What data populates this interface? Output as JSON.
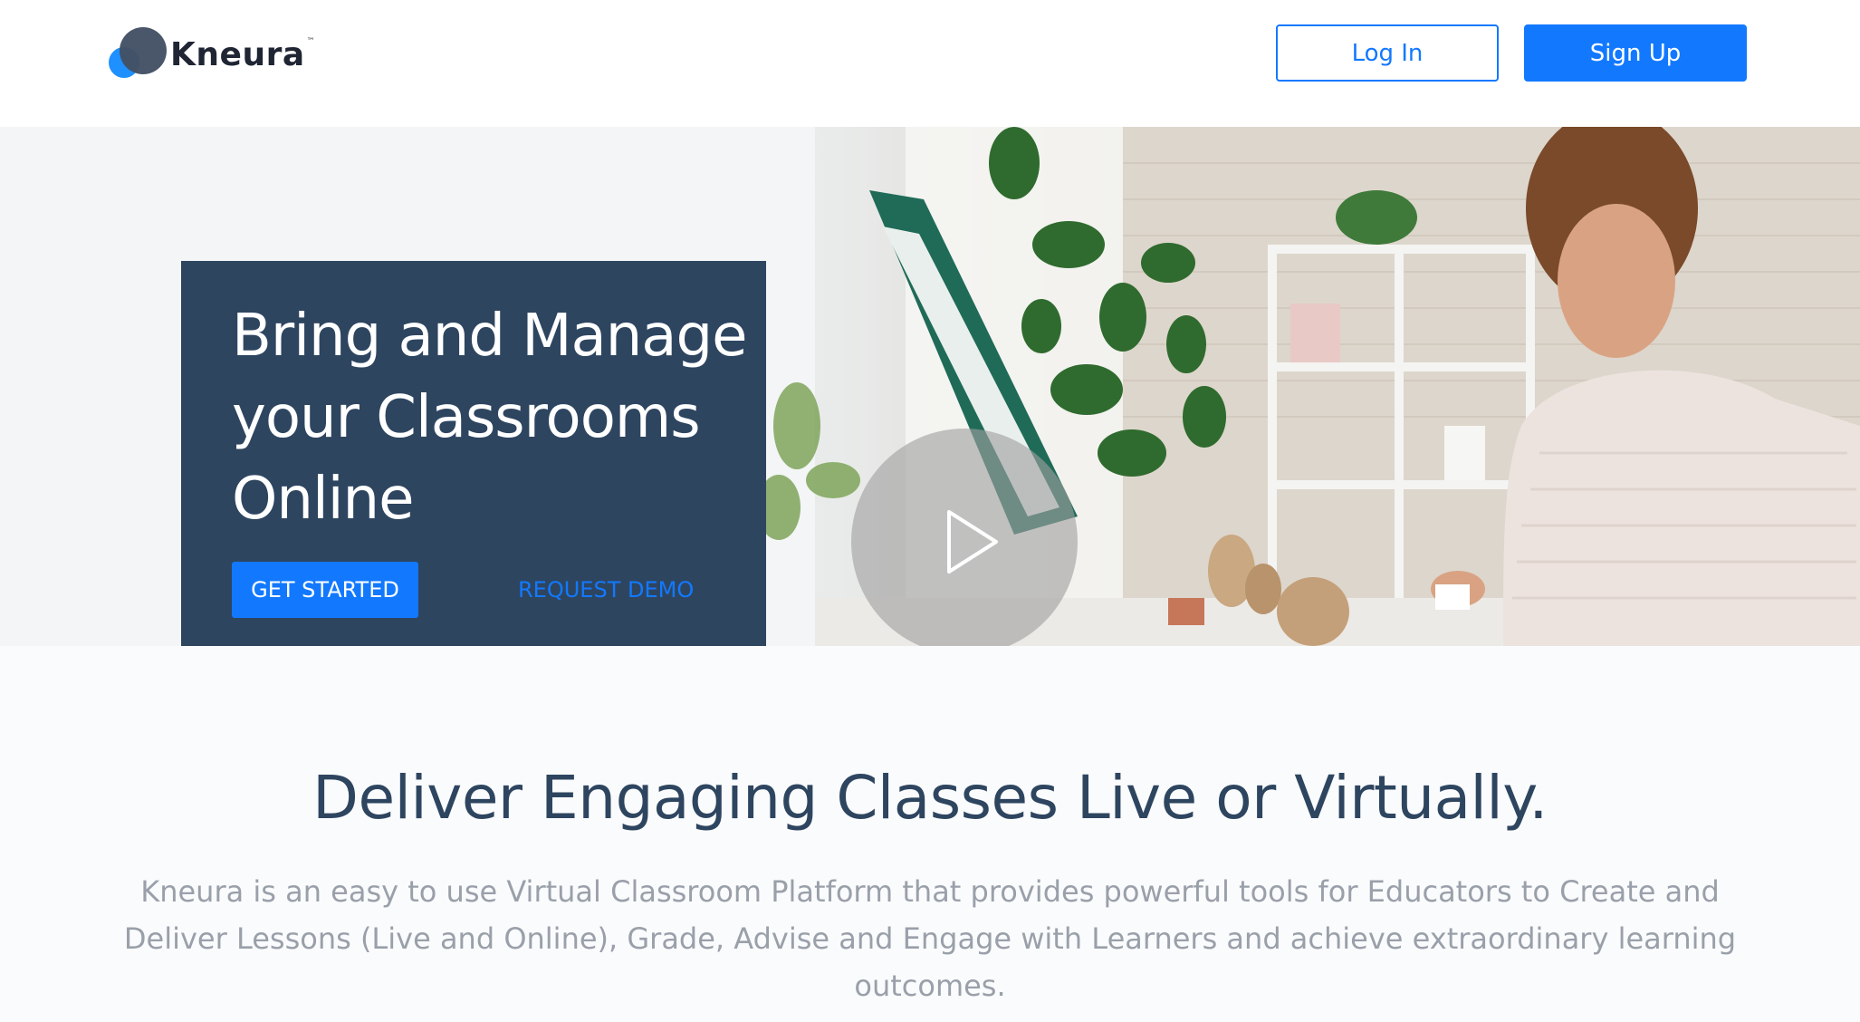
{
  "header": {
    "logo_text": "Kneura",
    "logo_tm": "™",
    "login_label": "Log In",
    "signup_label": "Sign Up"
  },
  "hero": {
    "title": "Bring and Manage your Classrooms Online",
    "get_started_label": "GET STARTED",
    "request_demo_label": "REQUEST DEMO",
    "play_icon": "play-icon"
  },
  "intro": {
    "title": "Deliver Engaging Classes Live or Virtually.",
    "body": "Kneura is an easy to use Virtual Classroom Platform that provides powerful tools for Educators to Create and Deliver Lessons (Live and Online), Grade, Advise and Engage with Learners and achieve extraordinary learning outcomes."
  },
  "colors": {
    "primary": "#1279ff",
    "hero_card": "#2e4560",
    "heading": "#2e4560",
    "body_text": "#9aa0aa"
  }
}
